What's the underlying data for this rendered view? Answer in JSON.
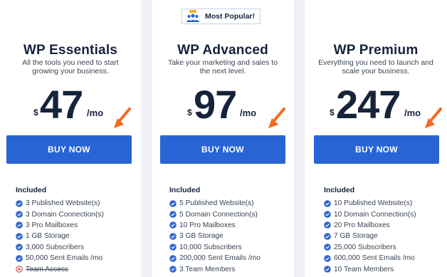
{
  "plans": [
    {
      "title": "WP Essentials",
      "description": "All the tools you need to start growing your business.",
      "currency": "$",
      "price": "47",
      "period": "/mo",
      "button_label": "BUY NOW",
      "included_label": "Included",
      "features": [
        {
          "label": "3 Published Website(s)",
          "included": true
        },
        {
          "label": "3 Domain Connection(s)",
          "included": true
        },
        {
          "label": "3 Pro Mailboxes",
          "included": true
        },
        {
          "label": "1 GB Storage",
          "included": true
        },
        {
          "label": "3,000 Subscribers",
          "included": true
        },
        {
          "label": "50,000 Sent Emails /mo",
          "included": true
        },
        {
          "label": "Team Access",
          "included": false
        }
      ]
    },
    {
      "badge": "Most Popular!",
      "title": "WP Advanced",
      "description": "Take your marketing and sales to the next level.",
      "currency": "$",
      "price": "97",
      "period": "/mo",
      "button_label": "BUY NOW",
      "included_label": "Included",
      "features": [
        {
          "label": "5 Published Website(s)",
          "included": true
        },
        {
          "label": "5 Domain Connection(s)",
          "included": true
        },
        {
          "label": "10 Pro Mailboxes",
          "included": true
        },
        {
          "label": "3 GB Storage",
          "included": true
        },
        {
          "label": "10,000 Subscribers",
          "included": true
        },
        {
          "label": "200,000 Sent Emails /mo",
          "included": true
        },
        {
          "label": "3 Team Members",
          "included": true
        }
      ]
    },
    {
      "title": "WP Premium",
      "description": "Everything you need to launch and scale your business.",
      "currency": "$",
      "price": "247",
      "period": "/mo",
      "button_label": "BUY NOW",
      "included_label": "Included",
      "features": [
        {
          "label": "10 Published Website(s)",
          "included": true
        },
        {
          "label": "10 Domain Connection(s)",
          "included": true
        },
        {
          "label": "20 Pro Mailboxes",
          "included": true
        },
        {
          "label": "7 GB Storage",
          "included": true
        },
        {
          "label": "25,000 Subscribers",
          "included": true
        },
        {
          "label": "600,000 Sent Emails /mo",
          "included": true
        },
        {
          "label": "10 Team Members",
          "included": true
        }
      ]
    }
  ],
  "icons": {
    "feature_included": "verified-check-icon",
    "feature_excluded": "x-circle-icon",
    "badge": "team-icon",
    "pointer": "orange-arrow-icon"
  },
  "colors": {
    "accent": "#2964d4",
    "check": "#2f66d0",
    "excluded": "#e0413a",
    "arrow": "#f26a21",
    "heading": "#16233b",
    "background": "#eef1f6"
  }
}
